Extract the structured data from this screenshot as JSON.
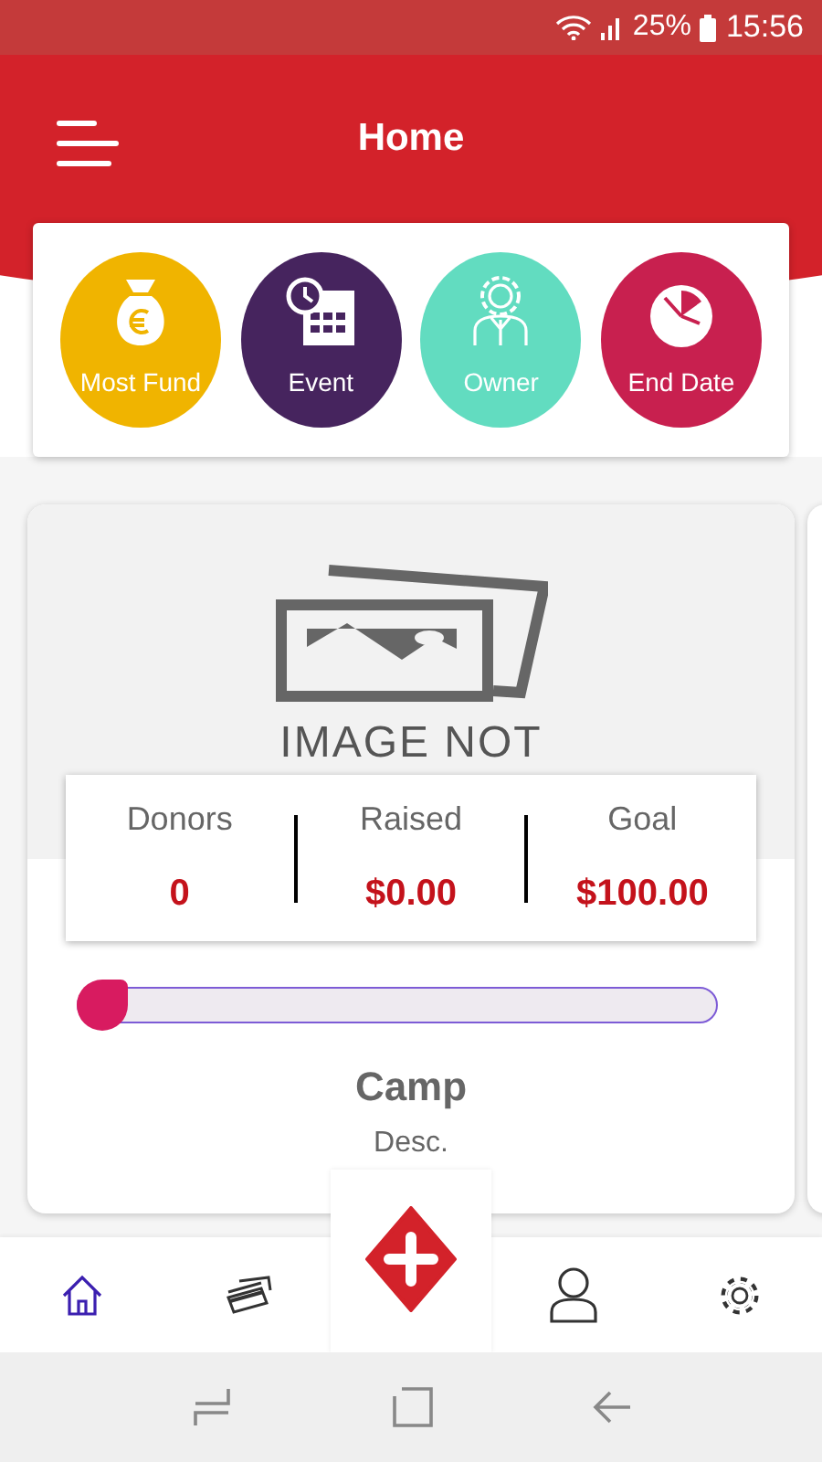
{
  "status_bar": {
    "battery": "25%",
    "time": "15:56"
  },
  "header": {
    "title": "Home"
  },
  "categories": [
    {
      "kind": "money",
      "label": "Most Fund",
      "color": "#f0b400"
    },
    {
      "kind": "calendar",
      "label": "Event",
      "color": "#46245e"
    },
    {
      "kind": "owner",
      "label": "Owner",
      "color": "#62dcc0"
    },
    {
      "kind": "clock",
      "label": "End Date",
      "color": "#c8204f"
    }
  ],
  "campaign": {
    "placeholder_text": "IMAGE NOT",
    "stats": [
      {
        "label": "Donors",
        "value": "0"
      },
      {
        "label": "Raised",
        "value": "$0.00"
      },
      {
        "label": "Goal",
        "value": "$100.00"
      }
    ],
    "level": 0,
    "title": "Camp",
    "description": "Desc."
  },
  "bottom_nav": [
    {
      "kind": "home",
      "selected": true
    },
    {
      "kind": "cards",
      "selected": false
    },
    {
      "kind": "add",
      "selected": false
    },
    {
      "kind": "profile",
      "selected": false
    },
    {
      "kind": "settings",
      "selected": false
    }
  ]
}
